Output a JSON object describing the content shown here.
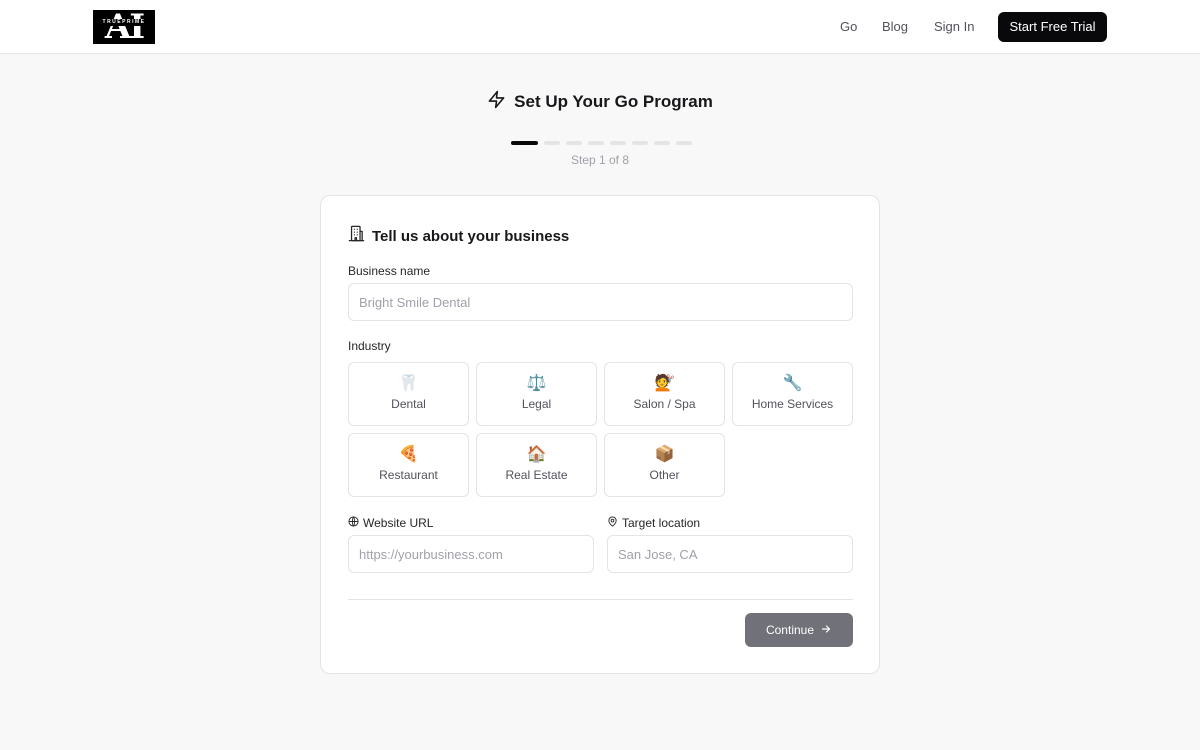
{
  "header": {
    "logo_text": "AI",
    "logo_subtext": "TRUEPRIME",
    "nav": [
      {
        "label": "Go"
      },
      {
        "label": "Blog"
      },
      {
        "label": "Sign In"
      }
    ],
    "cta_label": "Start Free Trial"
  },
  "wizard": {
    "title": "Set Up Your Go Program",
    "title_icon": "lightning-bolt-icon",
    "step_label": "Step 1 of 8",
    "current_step": 1,
    "total_steps": 8
  },
  "form": {
    "heading": "Tell us about your business",
    "heading_icon": "building-icon",
    "business_name": {
      "label": "Business name",
      "value": "",
      "placeholder": "Bright Smile Dental"
    },
    "industry": {
      "label": "Industry",
      "options": [
        {
          "emoji": "🦷",
          "label": "Dental"
        },
        {
          "emoji": "⚖️",
          "label": "Legal"
        },
        {
          "emoji": "💇",
          "label": "Salon / Spa"
        },
        {
          "emoji": "🔧",
          "label": "Home Services"
        },
        {
          "emoji": "🍕",
          "label": "Restaurant"
        },
        {
          "emoji": "🏠",
          "label": "Real Estate"
        },
        {
          "emoji": "📦",
          "label": "Other"
        }
      ]
    },
    "website": {
      "label": "Website URL",
      "icon": "globe-icon",
      "value": "",
      "placeholder": "https://yourbusiness.com"
    },
    "location": {
      "label": "Target location",
      "icon": "map-pin-icon",
      "value": "",
      "placeholder": "San Jose, CA"
    },
    "continue_label": "Continue"
  },
  "colors": {
    "background": "#f8f8f9",
    "primary": "#09090b",
    "border": "#e4e4e7",
    "muted_text": "#a1a1aa",
    "disabled_button": "#71717a"
  }
}
